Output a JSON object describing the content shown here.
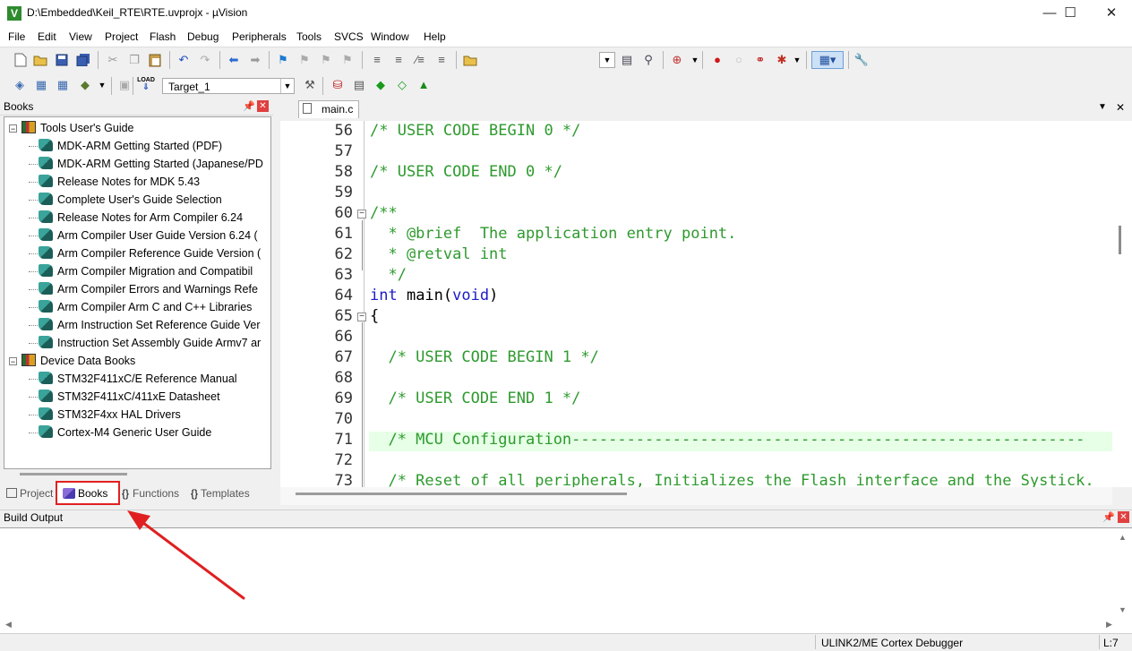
{
  "window": {
    "title": "D:\\Embedded\\Keil_RTE\\RTE.uvprojx - µVision",
    "app_icon": "V",
    "controls": {
      "minimize": "—",
      "maximize": "☐",
      "close": "✕"
    }
  },
  "menu": [
    "File",
    "Edit",
    "View",
    "Project",
    "Flash",
    "Debug",
    "Peripherals",
    "Tools",
    "SVCS",
    "Window",
    "Help"
  ],
  "build_toolbar": {
    "target": "Target_1",
    "load_label": "LOAD"
  },
  "books_panel": {
    "title": "Books",
    "groups": [
      {
        "label": "Tools User's Guide",
        "items": [
          "MDK-ARM Getting Started (PDF)",
          "MDK-ARM Getting Started (Japanese/PD",
          "Release Notes for MDK 5.43",
          "Complete User's Guide Selection",
          "Release Notes for Arm Compiler 6.24",
          "Arm Compiler User Guide Version 6.24 (",
          "Arm Compiler Reference Guide Version (",
          "Arm Compiler Migration and Compatibil",
          "Arm Compiler Errors and Warnings Refe",
          "Arm Compiler Arm C and C++ Libraries",
          "Arm Instruction Set Reference Guide Ver",
          "Instruction Set Assembly Guide Armv7 ar"
        ]
      },
      {
        "label": "Device Data Books",
        "items": [
          "STM32F411xC/E Reference Manual",
          "STM32F411xC/411xE Datasheet",
          "STM32F4xx HAL Drivers",
          "Cortex-M4 Generic User Guide"
        ]
      }
    ],
    "tabs": {
      "project": "Project",
      "books": "Books",
      "functions": "Functions",
      "templates": "Templates"
    }
  },
  "editor": {
    "active_tab": "main.c",
    "lines": [
      {
        "num": "56",
        "parts": [
          [
            "cmt",
            "/* USER CODE BEGIN 0 */"
          ]
        ]
      },
      {
        "num": "57",
        "parts": []
      },
      {
        "num": "58",
        "parts": [
          [
            "cmt",
            "/* USER CODE END 0 */"
          ]
        ]
      },
      {
        "num": "59",
        "parts": []
      },
      {
        "num": "60",
        "parts": [
          [
            "cmt",
            "/**"
          ]
        ]
      },
      {
        "num": "61",
        "parts": [
          [
            "cmt",
            "  * @brief  The application entry point."
          ]
        ]
      },
      {
        "num": "62",
        "parts": [
          [
            "cmt",
            "  * @retval int"
          ]
        ]
      },
      {
        "num": "63",
        "parts": [
          [
            "cmt",
            "  */"
          ]
        ]
      },
      {
        "num": "64",
        "parts": [
          [
            "kw",
            "int"
          ],
          [
            "txt",
            " main("
          ],
          [
            "kw",
            "void"
          ],
          [
            "txt",
            ")"
          ]
        ]
      },
      {
        "num": "65",
        "parts": [
          [
            "txt",
            "{"
          ]
        ]
      },
      {
        "num": "66",
        "parts": []
      },
      {
        "num": "67",
        "parts": [
          [
            "cmt",
            "  /* USER CODE BEGIN 1 */"
          ]
        ]
      },
      {
        "num": "68",
        "parts": []
      },
      {
        "num": "69",
        "parts": [
          [
            "cmt",
            "  /* USER CODE END 1 */"
          ]
        ]
      },
      {
        "num": "70",
        "parts": []
      },
      {
        "num": "71",
        "parts": [
          [
            "cmt",
            "  /* MCU Configuration--------------------------------------------------------"
          ]
        ]
      },
      {
        "num": "72",
        "parts": []
      },
      {
        "num": "73",
        "parts": [
          [
            "cmt",
            "  /* Reset of all peripherals, Initializes the Flash interface and the Systick."
          ]
        ]
      }
    ]
  },
  "build_output": {
    "title": "Build Output"
  },
  "status": {
    "debugger": "ULINK2/ME Cortex Debugger",
    "position": "L:7"
  },
  "colors": {
    "comment": "#2e9a2e",
    "keyword": "#1c1cc8",
    "highlight_line": "#e6ffe6",
    "annotation": "#e02020"
  }
}
